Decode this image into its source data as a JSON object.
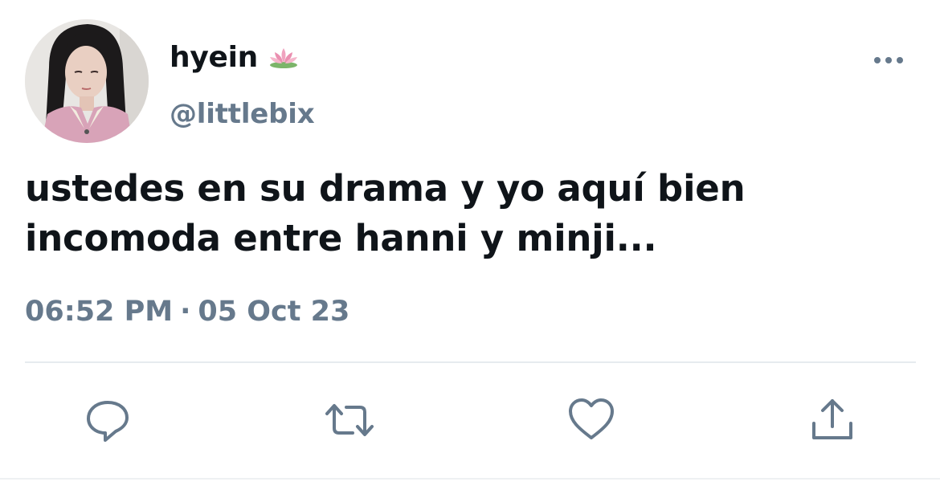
{
  "tweet": {
    "display_name": "hyein",
    "name_emoji": "lotus-icon",
    "handle": "@littlebix",
    "text_line1": "ustedes en su drama y yo aquí bien",
    "text_line2": "incomoda entre hanni y minji...",
    "time": "06:52 PM",
    "separator": "·",
    "date": "05 Oct 23"
  },
  "actions": [
    {
      "name": "reply",
      "icon": "reply-icon"
    },
    {
      "name": "retweet",
      "icon": "retweet-icon"
    },
    {
      "name": "like",
      "icon": "heart-icon"
    },
    {
      "name": "share",
      "icon": "share-icon"
    }
  ],
  "colors": {
    "text": "#0f1419",
    "secondary": "#66798c",
    "divider": "#e6ebef"
  }
}
